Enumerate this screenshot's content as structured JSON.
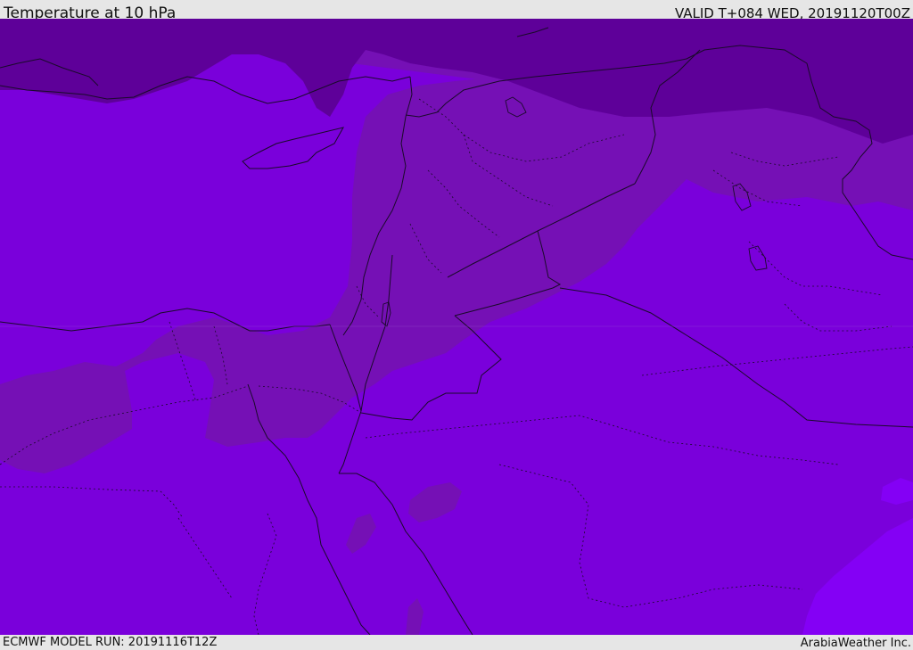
{
  "header": {
    "title": "Temperature at 10 hPa",
    "valid": "VALID T+084 WED, 20191120T00Z"
  },
  "footer": {
    "model_run": "ECMWF MODEL RUN: 20191116T12Z",
    "credit": "ArabiaWeather Inc."
  },
  "map": {
    "colors": {
      "band_dark": "#5e0099",
      "band_mid": "#7510b5",
      "band_main": "#7a00db",
      "band_light": "#8400f5",
      "border": "#1a0a2a"
    }
  }
}
